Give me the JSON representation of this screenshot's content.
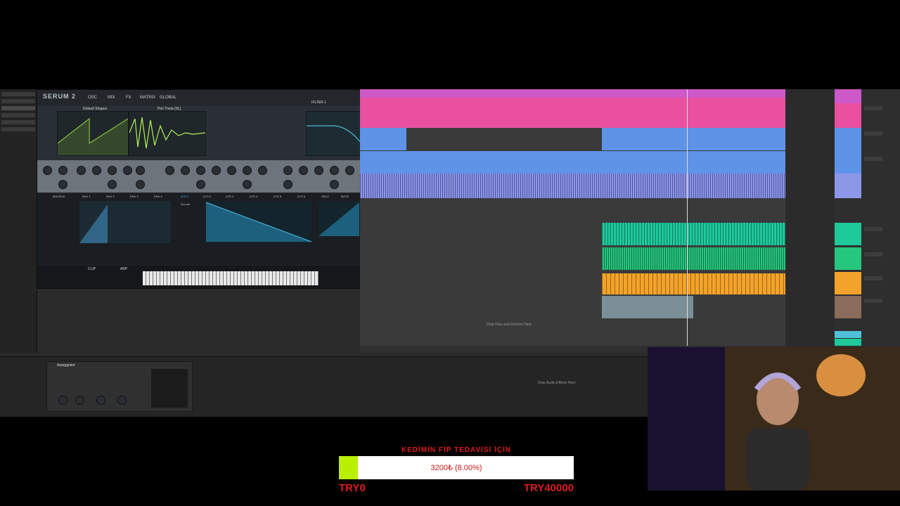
{
  "serum": {
    "logo": "SERUM 2",
    "tabs": [
      "OSC",
      "MIX",
      "FX",
      "MATRIX",
      "GLOBAL"
    ],
    "osc_a_label": "Default Shapes",
    "osc_b_label": "Thin Theta [SL]",
    "filter_label": "FILTER 1",
    "mod_tabs": [
      "MACROS",
      "ENV 1",
      "ENV 2",
      "ENV 3",
      "ENV 4",
      "LFO 1",
      "LFO 2",
      "LFO 3",
      "LFO 4",
      "LFO 5",
      "LFO 6",
      "VELO",
      "NOTE"
    ],
    "lfo_mode": "Normal",
    "arp_label": "ARP",
    "clip_label": "CLIP"
  },
  "arrangement": {
    "drop_hint": "Drop Files and Devices Here"
  },
  "device_view": {
    "arp_title": "Arpeggiator",
    "drop_fx_hint": "Drop Audio Effects Here"
  },
  "donation": {
    "title": "KEDİMİN FİP TEDAVİSİ İÇİN",
    "progress_text": "3200₺ (8.00%)",
    "progress_fraction": 0.08,
    "min_label": "TRY0",
    "max_label": "TRY40000"
  },
  "colors": {
    "clip_pink": "#e9509f",
    "clip_blue": "#5f93e8",
    "clip_lavender": "#8c97e8",
    "clip_teal": "#1ec99a",
    "clip_green": "#25c67e",
    "clip_orange": "#f2a32b",
    "donation_red": "#e21b1b",
    "donation_fill": "#b8f000"
  }
}
